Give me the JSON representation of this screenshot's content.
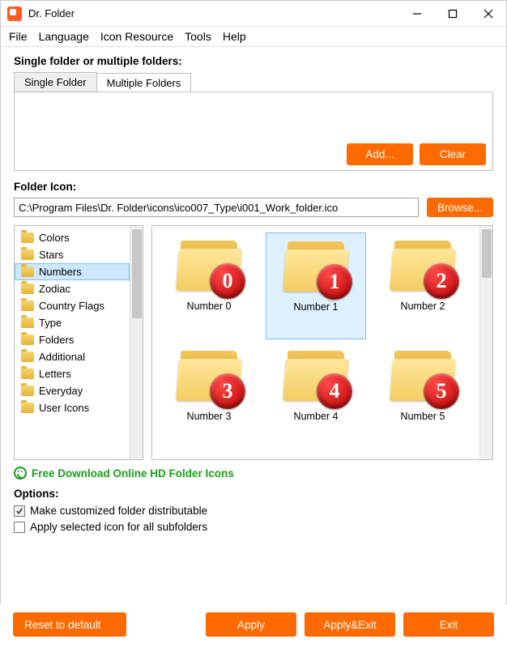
{
  "window": {
    "title": "Dr. Folder"
  },
  "menu": {
    "items": [
      "File",
      "Language",
      "Icon Resource",
      "Tools",
      "Help"
    ]
  },
  "folder_section": {
    "heading": "Single folder or multiple folders:",
    "tabs": [
      "Single Folder",
      "Multiple Folders"
    ],
    "active_tab": 1,
    "add_label": "Add...",
    "clear_label": "Clear"
  },
  "icon_section": {
    "heading": "Folder Icon:",
    "path": "C:\\Program Files\\Dr. Folder\\icons\\ico007_Type\\i001_Work_folder.ico",
    "browse_label": "Browse..."
  },
  "categories": {
    "items": [
      "Colors",
      "Stars",
      "Numbers",
      "Zodiac",
      "Country Flags",
      "Type",
      "Folders",
      "Additional",
      "Letters",
      "Everyday",
      "User Icons"
    ],
    "selected_index": 2
  },
  "icons_grid": {
    "items": [
      {
        "label": "Number 0",
        "digit": "0"
      },
      {
        "label": "Number 1",
        "digit": "1"
      },
      {
        "label": "Number 2",
        "digit": "2"
      },
      {
        "label": "Number 3",
        "digit": "3"
      },
      {
        "label": "Number 4",
        "digit": "4"
      },
      {
        "label": "Number 5",
        "digit": "5"
      }
    ],
    "selected_index": 1
  },
  "download_link": "Free Download Online HD Folder Icons",
  "options": {
    "heading": "Options:",
    "opt1": {
      "label": "Make customized folder distributable",
      "checked": true
    },
    "opt2": {
      "label": "Apply selected icon for all subfolders",
      "checked": false
    }
  },
  "buttons": {
    "reset": "Reset to default",
    "apply": "Apply",
    "apply_exit": "Apply&Exit",
    "exit": "Exit"
  }
}
